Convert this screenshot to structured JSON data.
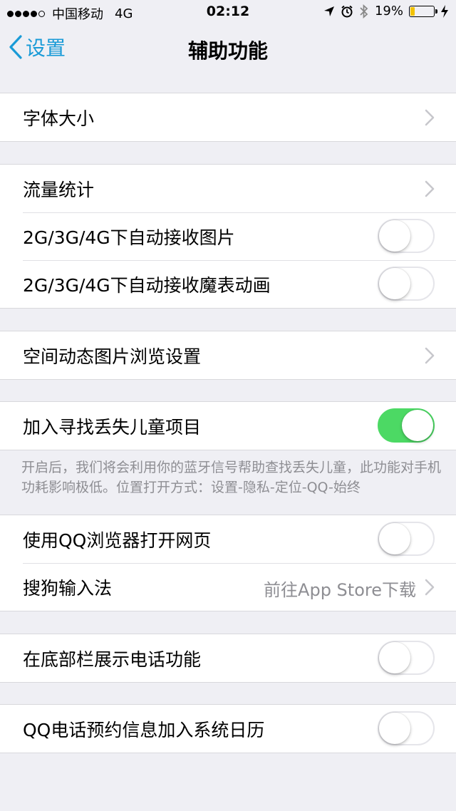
{
  "status": {
    "carrier": "中国移动",
    "network": "4G",
    "time": "02:12",
    "battery": "19%",
    "battery_level": 0.19,
    "battery_color": "#f2c200"
  },
  "nav": {
    "back_label": "设置",
    "title": "辅助功能",
    "accent": "#1a9bd7"
  },
  "groups": {
    "g1": {
      "font_size": "字体大小"
    },
    "g2": {
      "traffic": "流量统计",
      "auto_images": "2G/3G/4G下自动接收图片",
      "auto_magic": "2G/3G/4G下自动接收魔表动画"
    },
    "g3": {
      "space_images": "空间动态图片浏览设置"
    },
    "g4": {
      "lost_children": "加入寻找丢失儿童项目",
      "footnote": "开启后，我们将会利用你的蓝牙信号帮助查找丢失儿童，此功能对手机功耗影响极低。位置打开方式：设置-隐私-定位-QQ-始终"
    },
    "g5": {
      "qq_browser": "使用QQ浏览器打开网页",
      "sogou": "搜狗输入法",
      "sogou_detail": "前往App Store下载"
    },
    "g6": {
      "phone_bar": "在底部栏展示电话功能"
    },
    "g7": {
      "calendar": "QQ电话预约信息加入系统日历"
    }
  },
  "toggles": {
    "auto_images": false,
    "auto_magic": false,
    "lost_children": true,
    "qq_browser": false,
    "phone_bar": false,
    "calendar": false,
    "on_color": "#4cd964"
  }
}
